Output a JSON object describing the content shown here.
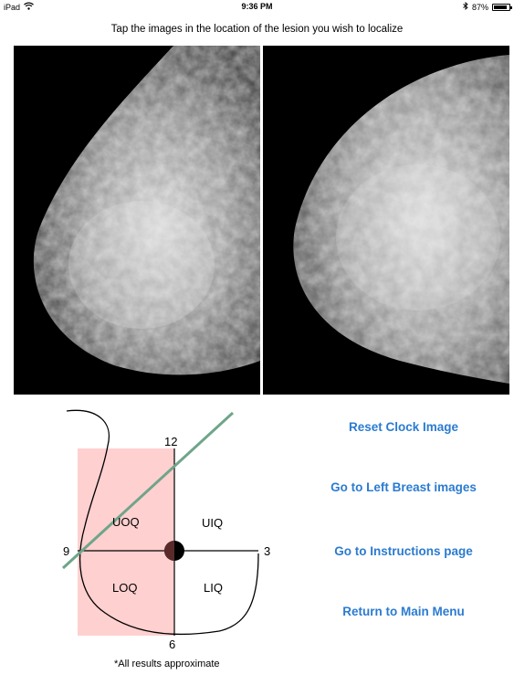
{
  "status_bar": {
    "device": "iPad",
    "time": "9:36 PM",
    "battery": "87%",
    "battery_level": 0.87
  },
  "instruction": "Tap the images in the location of the lesion you wish to localize",
  "clock": {
    "labels": {
      "twelve": "12",
      "three": "3",
      "six": "6",
      "nine": "9"
    },
    "quadrants": {
      "uoq": "UOQ",
      "uiq": "UIQ",
      "loq": "LOQ",
      "liq": "LIQ"
    },
    "footnote": "*All results approximate",
    "highlight_color": "#ffd0d0",
    "line_color": "#6fa58a"
  },
  "menu": {
    "reset": "Reset Clock Image",
    "left_breast": "Go to Left Breast images",
    "instructions": "Go to Instructions page",
    "main_menu": "Return to Main Menu"
  },
  "colors": {
    "accent": "#2b7bd0"
  }
}
